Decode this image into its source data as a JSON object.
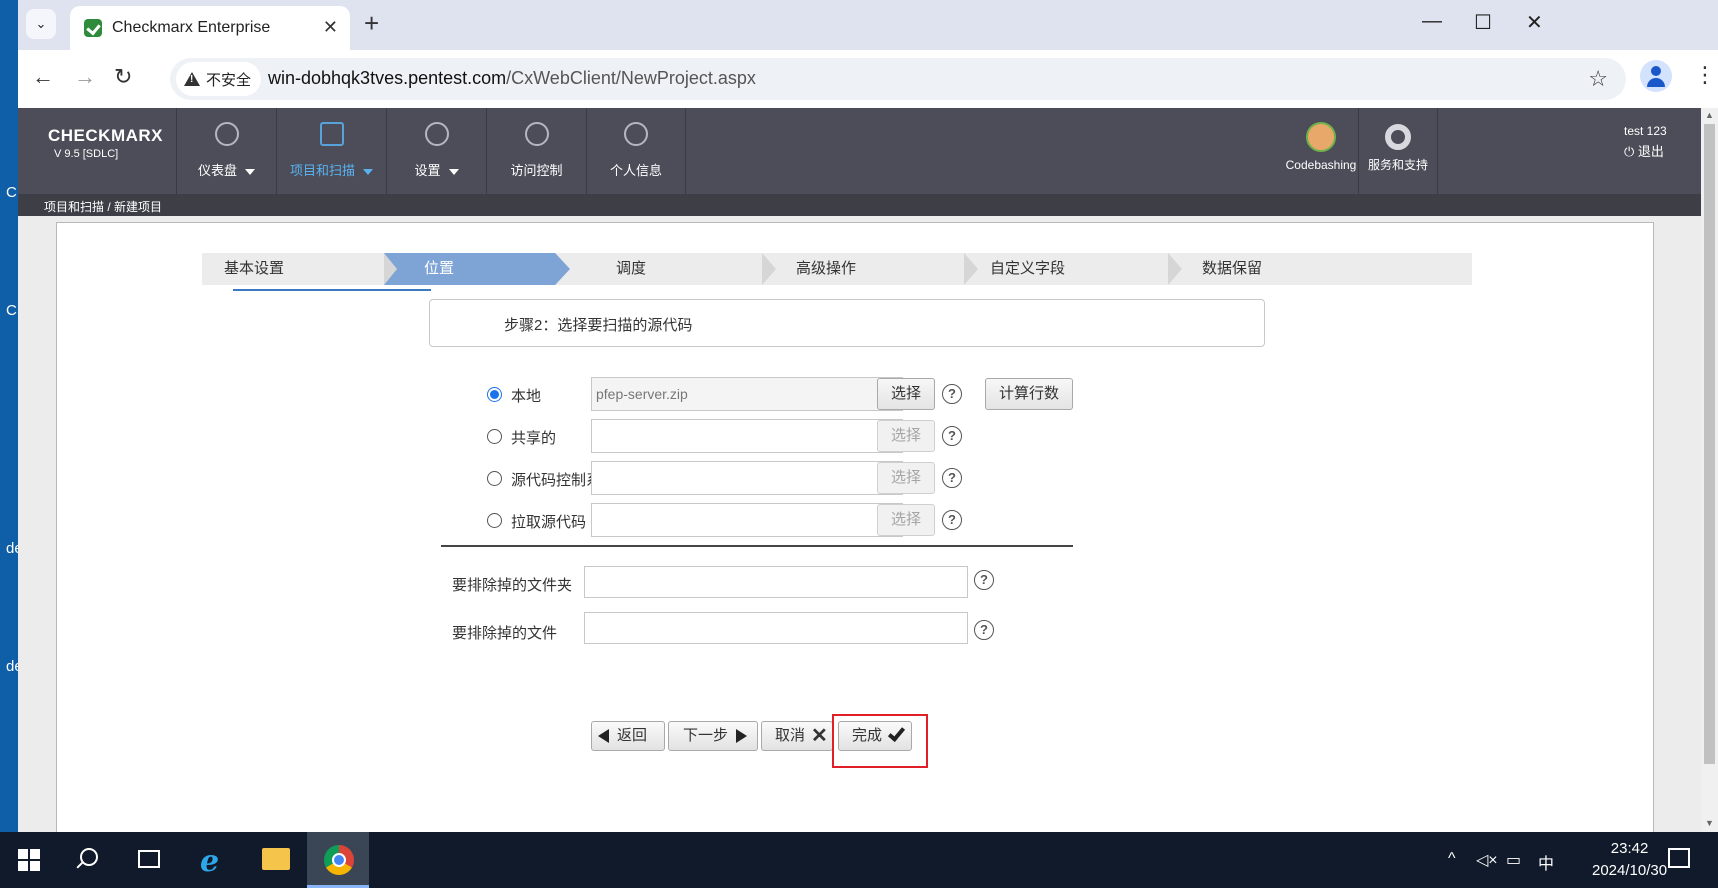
{
  "desktop": {
    "left_glyphs": [
      "C",
      "C",
      "de",
      "de"
    ]
  },
  "browser": {
    "tab_title": "Checkmarx Enterprise",
    "security_label": "不安全",
    "url_host": "win-dobhqk3tves.pentest.com",
    "url_path": "/CxWebClient/NewProject.aspx"
  },
  "header": {
    "logo": "CHECKMARX",
    "version": "V 9.5  [SDLC]",
    "nav": [
      {
        "label": "仪表盘",
        "icon": "gauge-icon"
      },
      {
        "label": "项目和扫描",
        "icon": "project-search-icon",
        "active": true
      },
      {
        "label": "设置",
        "icon": "wrench-icon"
      },
      {
        "label": "访问控制",
        "icon": "access-control-icon"
      },
      {
        "label": "个人信息",
        "icon": "user-settings-icon"
      }
    ],
    "codebashing": "Codebashing",
    "support": "服务和支持",
    "user": "test 123",
    "logout": "退出"
  },
  "breadcrumb": "项目和扫描 / 新建项目",
  "wizard": {
    "steps": [
      "基本设置",
      "位置",
      "调度",
      "高级操作",
      "自定义字段",
      "数据保留"
    ],
    "active_index": 1,
    "step_title": "步骤2：选择要扫描的源代码"
  },
  "source": {
    "options": [
      {
        "label": "本地",
        "value": "pfep-server.zip",
        "selected": true
      },
      {
        "label": "共享的",
        "value": "",
        "selected": false
      },
      {
        "label": "源代码控制系统",
        "value": "",
        "selected": false
      },
      {
        "label": "拉取源代码",
        "value": "",
        "selected": false
      }
    ],
    "choose_label": "选择",
    "count_lines_label": "计算行数",
    "help_glyph": "?"
  },
  "exclude": {
    "folders_label": "要排除掉的文件夹",
    "files_label": "要排除掉的文件"
  },
  "footer": {
    "back": "返回",
    "next": "下一步",
    "cancel": "取消",
    "finish": "完成"
  },
  "taskbar": {
    "ime": "中",
    "time": "23:42",
    "date": "2024/10/30"
  },
  "colors": {
    "header_bg": "#4d4d59",
    "active_nav": "#59b2f0",
    "wizard_active": "#7ea4d6",
    "highlight": "#e01f26"
  }
}
